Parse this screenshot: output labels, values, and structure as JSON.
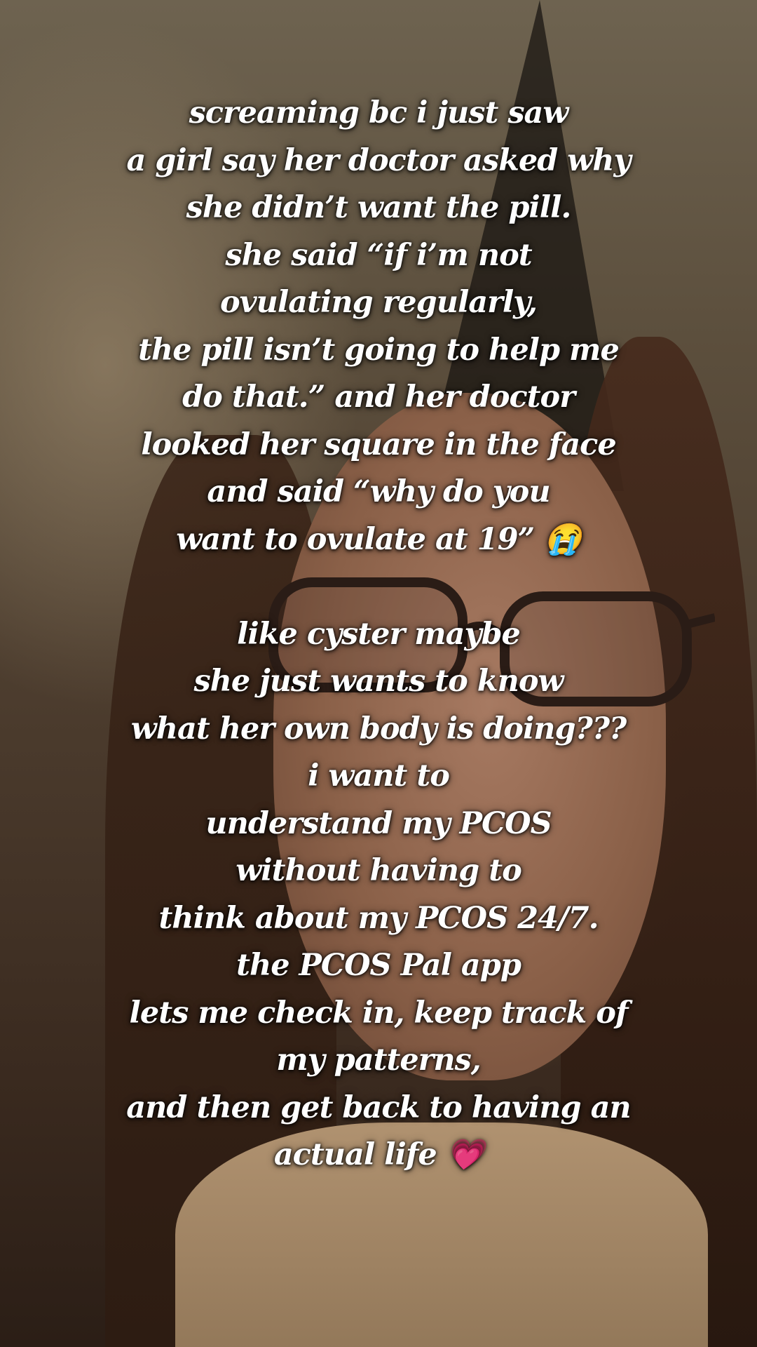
{
  "overlay": {
    "lines_part1": [
      "screaming bc i just saw",
      "a girl say her doctor asked why",
      "she didn’t want the pill.",
      "she said “if i’m not",
      "ovulating regularly,",
      "the pill isn’t going to help me",
      "do that.” and her doctor",
      "looked her square in the face",
      "and said “why do you",
      "want to ovulate at 19” 😭"
    ],
    "lines_part2": [
      "like cyster maybe",
      "she just wants to know",
      "what her own body is doing???",
      "i want to",
      "understand my PCOS",
      "without having to",
      "think about my PCOS 24/7.",
      "the PCOS Pal app",
      "lets me check in, keep track of",
      "my patterns,",
      "and then get back to having an",
      "actual life 💗"
    ]
  },
  "colors": {
    "text": "#ffffff",
    "text_shadow": "#000000"
  }
}
